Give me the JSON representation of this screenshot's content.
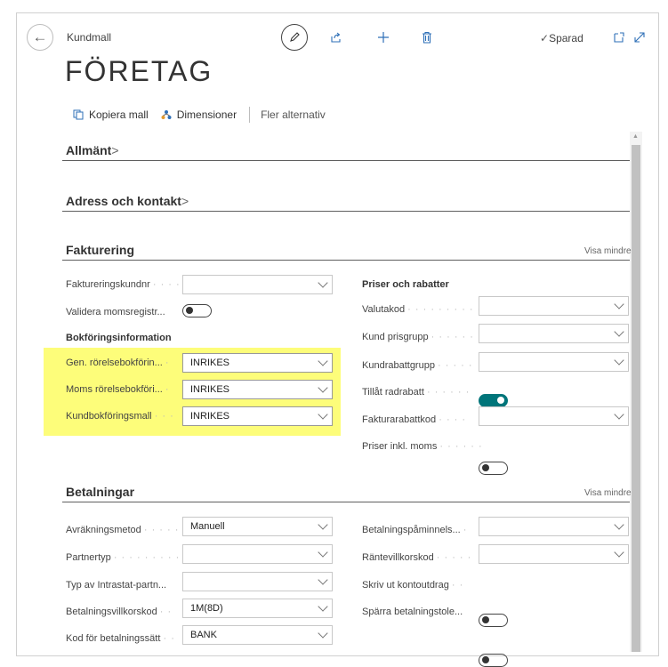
{
  "header": {
    "breadcrumb": "Kundmall",
    "title": "FÖRETAG",
    "saved_status": "Sparad"
  },
  "actions": {
    "copy_template": "Kopiera mall",
    "dimensions": "Dimensioner",
    "more_options": "Fler alternativ"
  },
  "sections": {
    "general": "Allmänt",
    "address": "Adress och kontakt",
    "invoicing": "Fakturering",
    "payments": "Betalningar",
    "show_less": "Visa mindre"
  },
  "invoicing": {
    "billing_customer_no": {
      "label": "Faktureringskundnr",
      "value": ""
    },
    "validate_vat": {
      "label": "Validera momsregistr...",
      "on": false
    },
    "posting_heading": "Bokföringsinformation",
    "gen_bus_posting": {
      "label": "Gen. rörelsebokförin...",
      "value": "INRIKES"
    },
    "vat_bus_posting": {
      "label": "Moms rörelsebokföri...",
      "value": "INRIKES"
    },
    "customer_posting": {
      "label": "Kundbokföringsmall",
      "value": "INRIKES"
    },
    "prices_heading": "Priser och rabatter",
    "currency_code": {
      "label": "Valutakod",
      "value": ""
    },
    "customer_price_group": {
      "label": "Kund prisgrupp",
      "value": ""
    },
    "customer_disc_group": {
      "label": "Kundrabattgrupp",
      "value": ""
    },
    "allow_line_disc": {
      "label": "Tillåt radrabatt",
      "on": true
    },
    "invoice_disc_code": {
      "label": "Fakturarabattkod",
      "value": ""
    },
    "prices_incl_vat": {
      "label": "Priser inkl. moms",
      "on": false
    }
  },
  "payments": {
    "application_method": {
      "label": "Avräkningsmetod",
      "value": "Manuell"
    },
    "partner_type": {
      "label": "Partnertyp",
      "value": ""
    },
    "intrastat_partner_type": {
      "label": "Typ av Intrastat-partn...",
      "value": ""
    },
    "payment_terms": {
      "label": "Betalningsvillkorskod",
      "value": "1M(8D)"
    },
    "payment_method": {
      "label": "Kod för betalningssätt",
      "value": "BANK"
    },
    "reminder_terms": {
      "label": "Betalningspåminnels...",
      "value": ""
    },
    "fin_charge_terms": {
      "label": "Räntevillkorskod",
      "value": ""
    },
    "print_statements": {
      "label": "Skriv ut kontoutdrag",
      "on": false
    },
    "block_payment_tolerance": {
      "label": "Spärra betalningstole...",
      "on": false
    }
  },
  "colors": {
    "highlight": "#fdfd7a",
    "toggle_on": "#00757a"
  }
}
